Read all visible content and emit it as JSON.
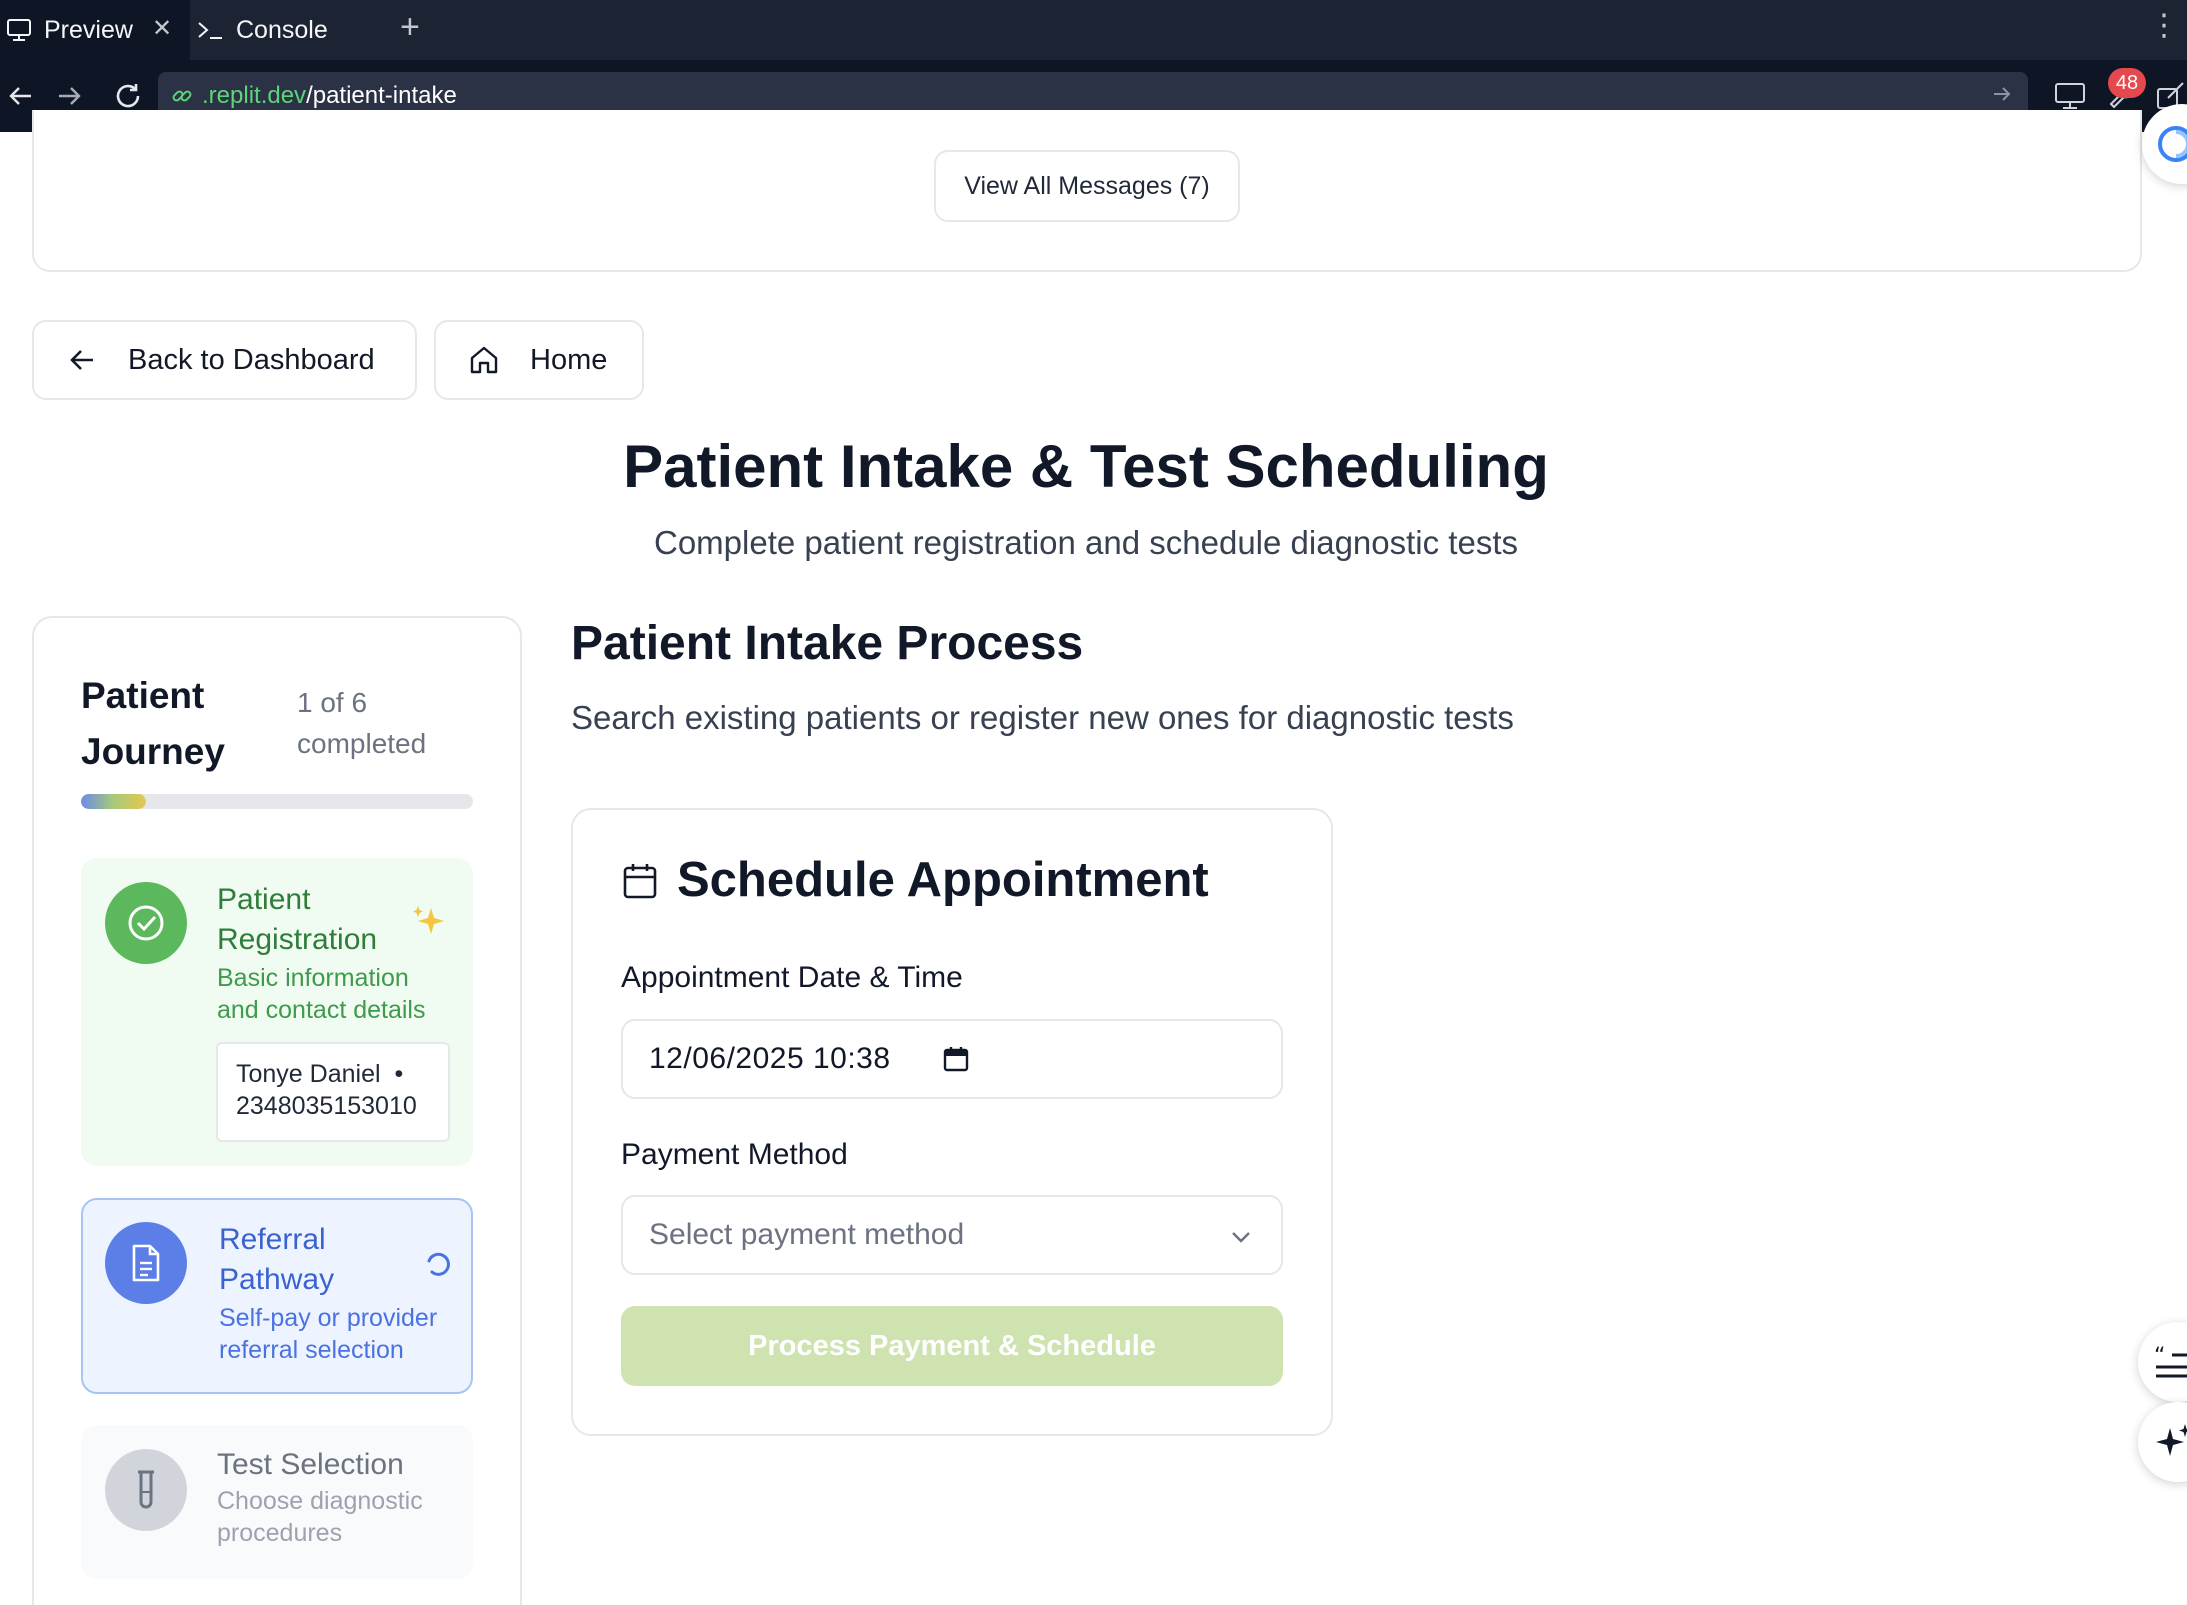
{
  "browser": {
    "tabs": [
      {
        "label": "Preview",
        "icon": "monitor-icon"
      },
      {
        "label": "Console",
        "icon": "terminal-icon"
      }
    ],
    "url": {
      "host": ".replit.dev",
      "path": "/patient-intake"
    },
    "notification_count": "48"
  },
  "messages": {
    "view_all_label": "View All Messages (7)"
  },
  "nav": {
    "back_label": "Back to Dashboard",
    "home_label": "Home"
  },
  "page": {
    "title": "Patient Intake & Test Scheduling",
    "subtitle": "Complete patient registration and schedule diagnostic tests"
  },
  "journey": {
    "title": "Patient Journey",
    "count": "1 of 6 completed",
    "progress_fraction": 0.1667,
    "steps": [
      {
        "name": "Patient Registration",
        "desc": "Basic information and contact details",
        "status": "completed",
        "icon": "check-circle-icon",
        "color": "#5cb85c"
      },
      {
        "name": "Referral Pathway",
        "desc": "Self-pay or provider referral selection",
        "status": "in-progress",
        "icon": "document-icon",
        "color": "#5b7fe6"
      },
      {
        "name": "Test Selection",
        "desc": "Choose diagnostic procedures",
        "status": "pending",
        "icon": "test-tube-icon",
        "color": "#d1d5db"
      }
    ],
    "patient": {
      "name": "Tonye Daniel",
      "separator": "•",
      "phone": "2348035153010"
    }
  },
  "main": {
    "title": "Patient Intake Process",
    "subtitle": "Search existing patients or register new ones for diagnostic tests"
  },
  "appointment": {
    "title": "Schedule Appointment",
    "date_label": "Appointment Date & Time",
    "date_value": "12/06/2025 10:38",
    "payment_label": "Payment Method",
    "payment_placeholder": "Select payment method",
    "submit_label": "Process Payment & Schedule"
  },
  "colors": {
    "completed": "#5cb85c",
    "active": "#5b7fe6",
    "submit_disabled": "#cfe3b1"
  }
}
